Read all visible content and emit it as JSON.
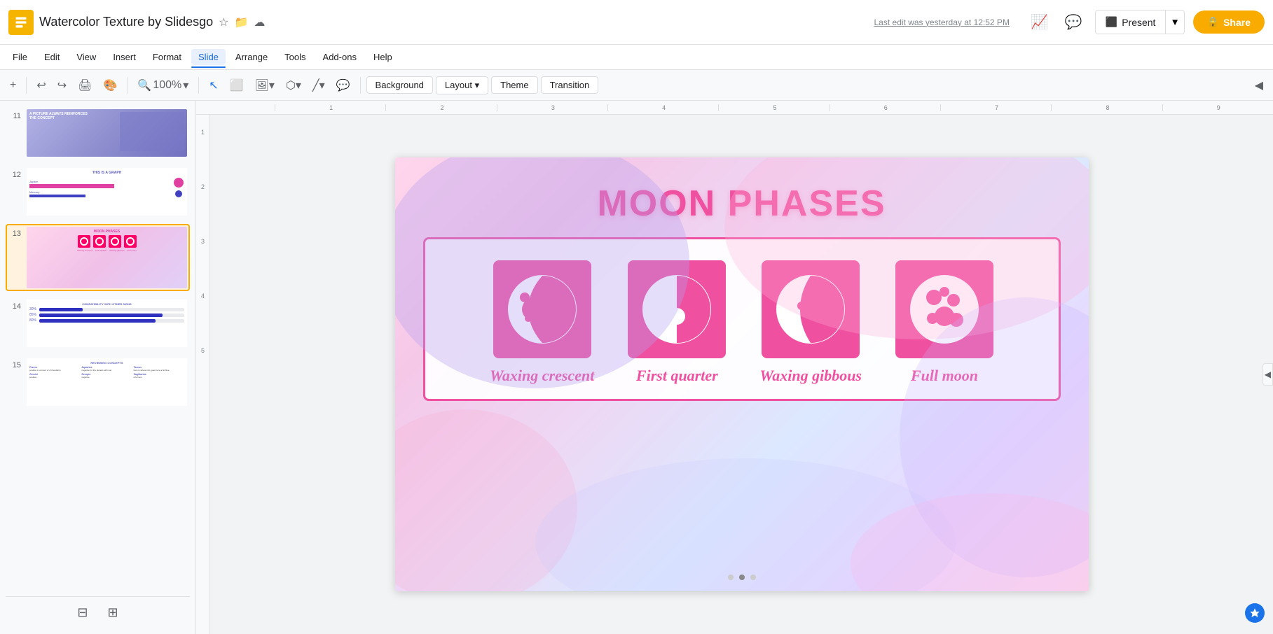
{
  "app": {
    "logo_color": "#f4b400",
    "title": "Watercolor Texture by Slidesgo",
    "last_edit": "Last edit was yesterday at 12:52 PM"
  },
  "header": {
    "present_label": "Present",
    "share_label": "Share",
    "share_icon": "🔒"
  },
  "menu": {
    "items": [
      "File",
      "Edit",
      "View",
      "Insert",
      "Format",
      "Slide",
      "Arrange",
      "Tools",
      "Add-ons",
      "Help"
    ]
  },
  "toolbar": {
    "zoom_label": "100%",
    "background_label": "Background",
    "layout_label": "Layout",
    "theme_label": "Theme",
    "transition_label": "Transition"
  },
  "sidebar": {
    "slides": [
      {
        "num": "11",
        "type": "purple-text"
      },
      {
        "num": "12",
        "type": "graph"
      },
      {
        "num": "13",
        "type": "moon-phases",
        "active": true
      },
      {
        "num": "14",
        "type": "compatibility"
      },
      {
        "num": "15",
        "type": "reviewing"
      }
    ]
  },
  "slide": {
    "title": "MOON PHASES",
    "title_color": "#f050a0",
    "phases": [
      {
        "label": "Waxing crescent",
        "icon_type": "waxing-crescent"
      },
      {
        "label": "First quarter",
        "icon_type": "first-quarter"
      },
      {
        "label": "Waxing gibbous",
        "icon_type": "waxing-gibbous"
      },
      {
        "label": "Full moon",
        "icon_type": "full-moon"
      }
    ]
  },
  "ruler": {
    "ticks": [
      "1",
      "2",
      "3",
      "4",
      "5",
      "6",
      "7",
      "8",
      "9"
    ]
  }
}
